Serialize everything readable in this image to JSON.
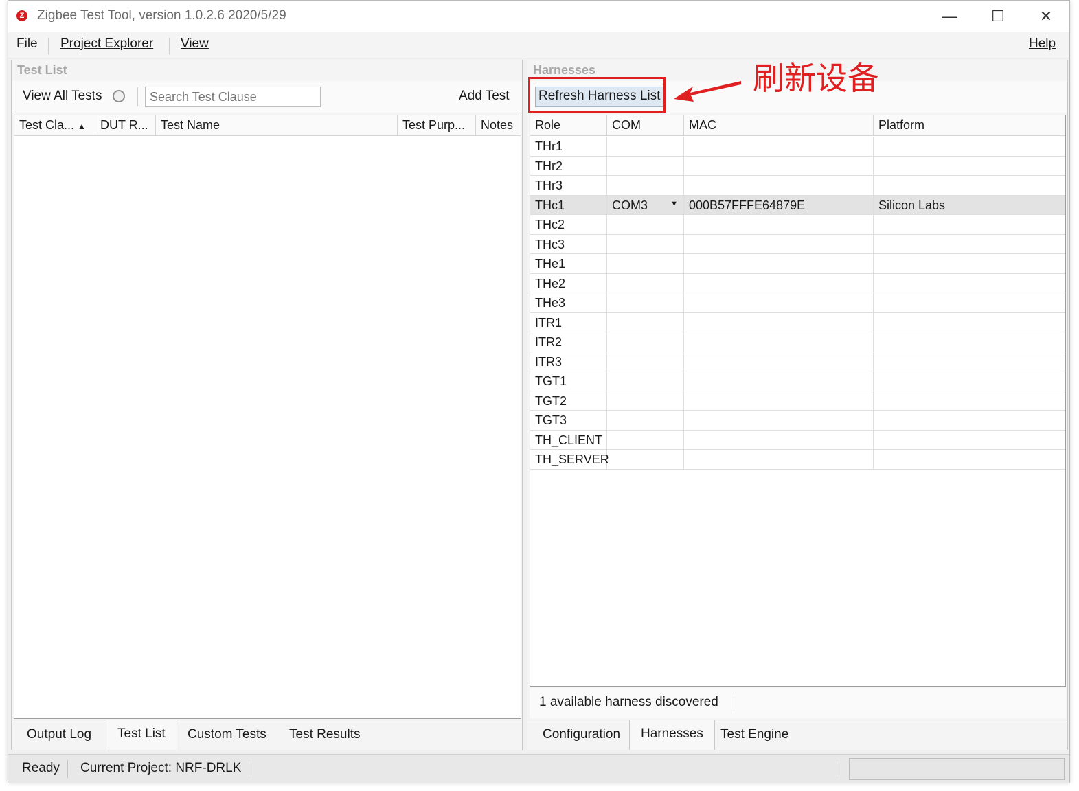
{
  "window": {
    "title": "Zigbee Test Tool, version 1.0.2.6 2020/5/29",
    "icon_glyph": "Z"
  },
  "menu": {
    "file": "File",
    "project_explorer": "Project Explorer",
    "view": "View",
    "help": "Help"
  },
  "left_panel": {
    "header": "Test List",
    "view_all_tests": "View All Tests",
    "search_placeholder": "Search Test Clause",
    "add_test": "Add Test",
    "columns": [
      "Test Cla...",
      "DUT R...",
      "Test Name",
      "Test Purp...",
      "Notes"
    ],
    "tabs": [
      "Output Log",
      "Test List",
      "Custom Tests",
      "Test Results"
    ],
    "active_tab": "Test List"
  },
  "right_panel": {
    "header": "Harnesses",
    "refresh_button": "Refresh Harness List",
    "annotation": "刷新设备",
    "columns": [
      "Role",
      "COM",
      "MAC",
      "Platform"
    ],
    "rows": [
      {
        "role": "THr1",
        "com": "",
        "mac": "",
        "platform": ""
      },
      {
        "role": "THr2",
        "com": "",
        "mac": "",
        "platform": ""
      },
      {
        "role": "THr3",
        "com": "",
        "mac": "",
        "platform": ""
      },
      {
        "role": "THc1",
        "com": "COM3",
        "mac": "000B57FFFE64879E",
        "platform": "Silicon Labs"
      },
      {
        "role": "THc2",
        "com": "",
        "mac": "",
        "platform": ""
      },
      {
        "role": "THc3",
        "com": "",
        "mac": "",
        "platform": ""
      },
      {
        "role": "THe1",
        "com": "",
        "mac": "",
        "platform": ""
      },
      {
        "role": "THe2",
        "com": "",
        "mac": "",
        "platform": ""
      },
      {
        "role": "THe3",
        "com": "",
        "mac": "",
        "platform": ""
      },
      {
        "role": "ITR1",
        "com": "",
        "mac": "",
        "platform": ""
      },
      {
        "role": "ITR2",
        "com": "",
        "mac": "",
        "platform": ""
      },
      {
        "role": "ITR3",
        "com": "",
        "mac": "",
        "platform": ""
      },
      {
        "role": "TGT1",
        "com": "",
        "mac": "",
        "platform": ""
      },
      {
        "role": "TGT2",
        "com": "",
        "mac": "",
        "platform": ""
      },
      {
        "role": "TGT3",
        "com": "",
        "mac": "",
        "platform": ""
      },
      {
        "role": "TH_CLIENT",
        "com": "",
        "mac": "",
        "platform": ""
      },
      {
        "role": "TH_SERVER",
        "com": "",
        "mac": "",
        "platform": ""
      }
    ],
    "selected_role": "THc1",
    "footer": "1 available harness discovered",
    "tabs": [
      "Configuration",
      "Harnesses",
      "Test Engine"
    ],
    "active_tab": "Harnesses"
  },
  "status": {
    "ready": "Ready",
    "project": "Current Project: NRF-DRLK"
  },
  "colors": {
    "accent_red": "#e02020",
    "selected_row": "#e3e3e3"
  }
}
